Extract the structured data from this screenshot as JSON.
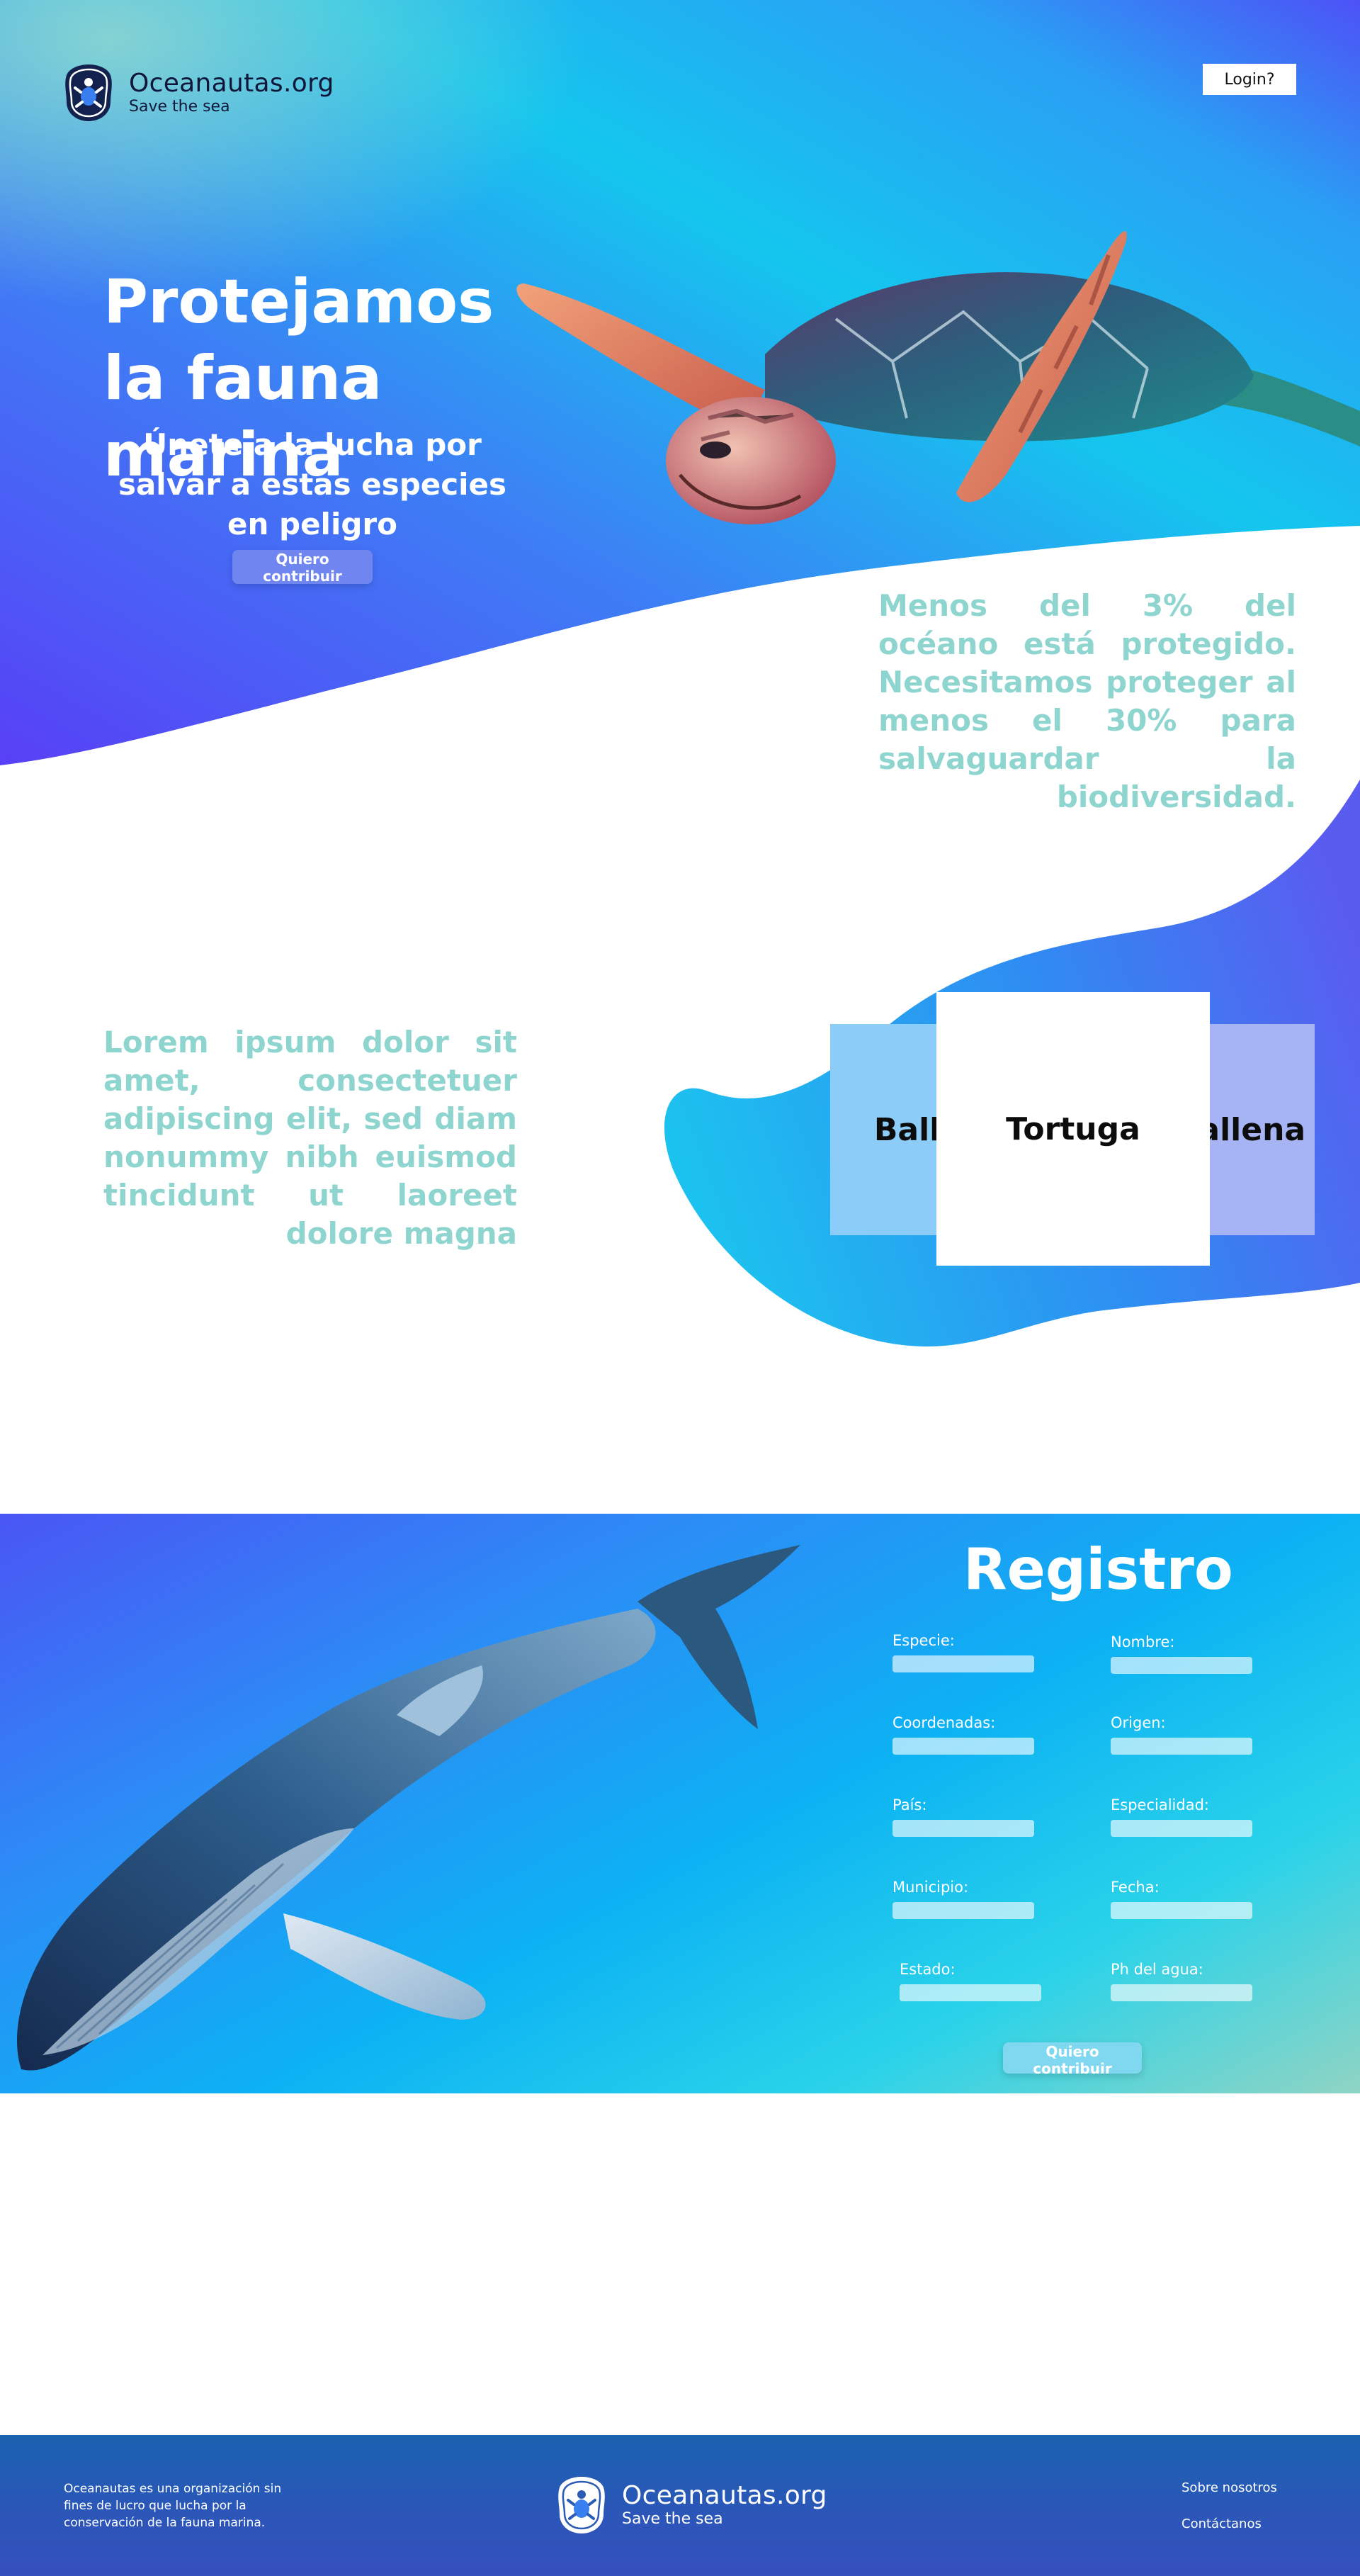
{
  "brand": {
    "name": "Oceanautas.org",
    "tagline": "Save the sea",
    "logo_icon": "turtle-shield-icon"
  },
  "header": {
    "login_label": "Login?"
  },
  "hero": {
    "title": "Protejamos la fauna marina",
    "subtitle": "Únete a la lucha por salvar a estas especies en peligro",
    "cta_label": "Quiero contribuir",
    "image_icon": "sea-turtle-illustration"
  },
  "fact": {
    "text": "Menos del 3% del océano está protegido. Necesitamos proteger al menos el 30% para salvaguardar la biodiversidad."
  },
  "species": {
    "intro": "Lorem ipsum dolor sit amet, consectetuer adipiscing elit, sed diam nonummy nibh euismod tincidunt ut laoreet dolore magna",
    "cards": [
      {
        "label": "Ballena"
      },
      {
        "label": "Tortuga"
      },
      {
        "label": "Ballena"
      }
    ]
  },
  "registro": {
    "title": "Registro",
    "image_icon": "humpback-whale-illustration",
    "fields": {
      "especie": "Especie:",
      "nombre": "Nombre:",
      "coordenadas": "Coordenadas:",
      "origen": "Origen:",
      "pais": "País:",
      "especialidad": "Especialidad:",
      "municipio": "Municipio:",
      "fecha": "Fecha:",
      "estado": "Estado:",
      "ph": "Ph del agua:"
    },
    "cta_label": "Quiero contribuir"
  },
  "footer": {
    "about": "Oceanautas es una organización sin fines de lucro que lucha por la conservación de la fauna marina.",
    "links": {
      "about_us": "Sobre nosotros",
      "contact": "Contáctanos"
    }
  },
  "colors": {
    "hero_gradient_start": "#4f45f6",
    "hero_gradient_mid": "#12c8ec",
    "teal_text": "#8fd5cf",
    "footer_blue": "#1a62b0"
  }
}
